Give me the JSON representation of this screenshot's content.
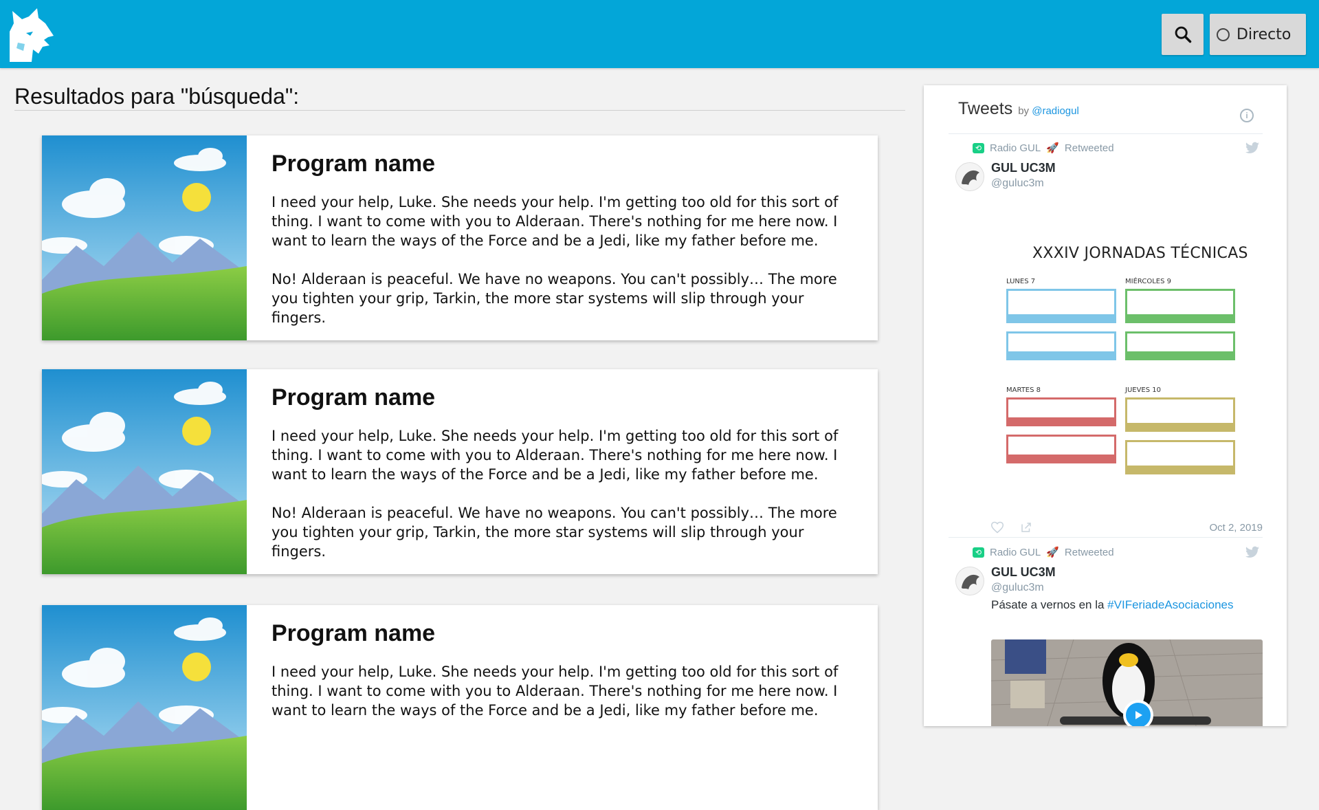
{
  "header": {
    "logo_icon": "lynx-logo-icon",
    "search_icon": "search-icon",
    "live_label": "Directo",
    "accent_color": "#03a6d8"
  },
  "results": {
    "title": "Resultados para \"búsqueda\":"
  },
  "programs": [
    {
      "name": "Program name",
      "paragraphs": [
        "I need your help, Luke. She needs your help. I'm getting too old for this sort of thing. I want to come with you to Alderaan. There's nothing for me here now. I want to learn the ways of the Force and be a Jedi, like my father before me.",
        "No! Alderaan is peaceful. We have no weapons. You can't possibly… The more you tighten your grip, Tarkin, the more star systems will slip through your fingers."
      ]
    },
    {
      "name": "Program name",
      "paragraphs": [
        "I need your help, Luke. She needs your help. I'm getting too old for this sort of thing. I want to come with you to Alderaan. There's nothing for me here now. I want to learn the ways of the Force and be a Jedi, like my father before me.",
        "No! Alderaan is peaceful. We have no weapons. You can't possibly… The more you tighten your grip, Tarkin, the more star systems will slip through your fingers."
      ]
    },
    {
      "name": "Program name",
      "paragraphs": [
        "I need your help, Luke. She needs your help. I'm getting too old for this sort of thing. I want to come with you to Alderaan. There's nothing for me here now. I want to learn the ways of the Force and be a Jedi, like my father before me."
      ]
    }
  ],
  "twitter": {
    "title": "Tweets",
    "by": "by",
    "handle": "@radiogul",
    "tweets": [
      {
        "retweeted_by": "Radio GUL",
        "retweeted_label": "Retweeted",
        "author": "GUL UC3M",
        "handle": "@guluc3m",
        "date": "Oct 2, 2019",
        "poster": {
          "title": "XXXIV JORNADAS TÉCNICAS",
          "days": [
            "LUNES 7",
            "MIÉRCOLES 9",
            "MARTES 8",
            "JUEVES 10"
          ],
          "colors": {
            "blue": "#7fc6e8",
            "green": "#6cbf6a",
            "red": "#d46a6a",
            "olive": "#c6b86a"
          }
        }
      },
      {
        "retweeted_by": "Radio GUL",
        "retweeted_label": "Retweeted",
        "author": "GUL UC3M",
        "handle": "@guluc3m",
        "text_prefix": "Pásate a vernos en la ",
        "hashtag": "#VIFeriadeAsociaciones"
      }
    ]
  }
}
